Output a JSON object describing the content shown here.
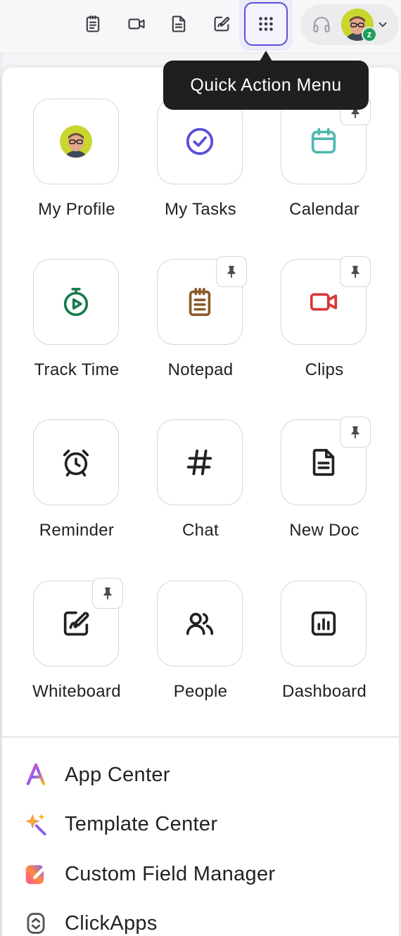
{
  "topbar": {
    "icons": [
      "notepad-icon",
      "video-clip-icon",
      "doc-icon",
      "whiteboard-icon",
      "grid-menu-icon"
    ],
    "headset_icon": "headset-icon",
    "status_badge": "z",
    "accent_color": "#5b4fd6"
  },
  "tooltip": {
    "text": "Quick Action Menu"
  },
  "tiles": [
    {
      "label": "My Profile",
      "icon": "avatar",
      "pinned": false
    },
    {
      "label": "My Tasks",
      "icon": "check-circle-icon",
      "color": "#5b4fd6",
      "pinned": false
    },
    {
      "label": "Calendar",
      "icon": "calendar-icon",
      "color": "#4fb8b0",
      "pinned": true
    },
    {
      "label": "Track Time",
      "icon": "stopwatch-icon",
      "color": "#1a7a4c",
      "pinned": false
    },
    {
      "label": "Notepad",
      "icon": "notepad-icon",
      "color": "#8b5a2b",
      "pinned": true
    },
    {
      "label": "Clips",
      "icon": "video-clip-icon",
      "color": "#d93636",
      "pinned": true
    },
    {
      "label": "Reminder",
      "icon": "alarm-clock-icon",
      "color": "#222222",
      "pinned": false
    },
    {
      "label": "Chat",
      "icon": "hashtag-icon",
      "color": "#222222",
      "pinned": false
    },
    {
      "label": "New Doc",
      "icon": "doc-icon",
      "color": "#222222",
      "pinned": true
    },
    {
      "label": "Whiteboard",
      "icon": "whiteboard-icon",
      "color": "#222222",
      "pinned": true
    },
    {
      "label": "People",
      "icon": "people-icon",
      "color": "#222222",
      "pinned": false
    },
    {
      "label": "Dashboard",
      "icon": "dashboard-icon",
      "color": "#222222",
      "pinned": false
    }
  ],
  "menu": [
    {
      "label": "App Center",
      "icon": "app-center-icon"
    },
    {
      "label": "Template Center",
      "icon": "template-center-icon"
    },
    {
      "label": "Custom Field Manager",
      "icon": "custom-field-icon"
    },
    {
      "label": "ClickApps",
      "icon": "clickapps-icon"
    }
  ]
}
